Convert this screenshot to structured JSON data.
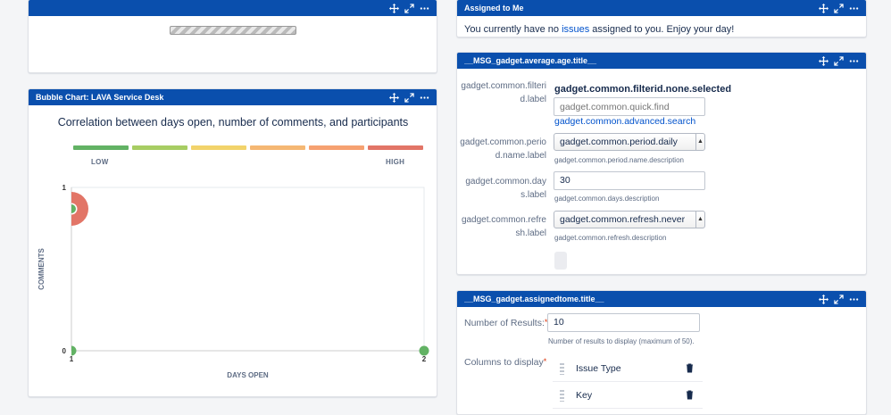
{
  "loading_gadget": {},
  "bubble_gadget": {
    "title": "Bubble Chart: LAVA Service Desk",
    "chart_title": "Correlation between days open, number of comments, and participants",
    "legend_low": "LOW",
    "legend_high": "HIGH",
    "legend_colors": [
      "#62b264",
      "#a7cd63",
      "#f2d36b",
      "#f5b773",
      "#f6a171",
      "#e27567"
    ]
  },
  "chart_data": {
    "type": "scatter",
    "title": "Correlation between days open, number of comments, and participants",
    "xlabel": "DAYS OPEN",
    "ylabel": "COMMENTS",
    "x_ticks": [
      "1",
      "2"
    ],
    "y_ticks": [
      "0",
      "1"
    ],
    "xlim": [
      1,
      2
    ],
    "ylim": [
      0,
      1
    ],
    "points": [
      {
        "x": 1,
        "y": 1,
        "size": 2,
        "color": "#62b264",
        "halo": "#e27567"
      },
      {
        "x": 1,
        "y": 0,
        "size": 1,
        "color": "#62b264"
      },
      {
        "x": 2,
        "y": 0,
        "size": 1,
        "color": "#62b264"
      }
    ]
  },
  "assigned_gadget": {
    "title": "Assigned to Me",
    "msg_before": "You currently have no ",
    "msg_link": "issues",
    "msg_after": " assigned to you. Enjoy your day!"
  },
  "average_age_gadget": {
    "title": "__MSG_gadget.average.age.title__",
    "filter_label": "gadget.common.filterid.label",
    "filter_none": "gadget.common.filterid.none.selected",
    "quick_find_placeholder": "gadget.common.quick.find",
    "advanced_search": "gadget.common.advanced.search",
    "period_label": "gadget.common.period.name.label",
    "period_value": "gadget.common.period.daily",
    "period_desc": "gadget.common.period.name.description",
    "days_label": "gadget.common.days.label",
    "days_value": "30",
    "days_desc": "gadget.common.days.description",
    "refresh_label": "gadget.common.refresh.label",
    "refresh_value": "gadget.common.refresh.never",
    "refresh_desc": "gadget.common.refresh.description"
  },
  "assigned_config_gadget": {
    "title": "__MSG_gadget.assignedtome.title__",
    "results_label": "Number of Results:",
    "results_value": "10",
    "results_desc": "Number of results to display (maximum of 50).",
    "columns_label": "Columns to display",
    "columns": [
      "Issue Type",
      "Key"
    ]
  }
}
